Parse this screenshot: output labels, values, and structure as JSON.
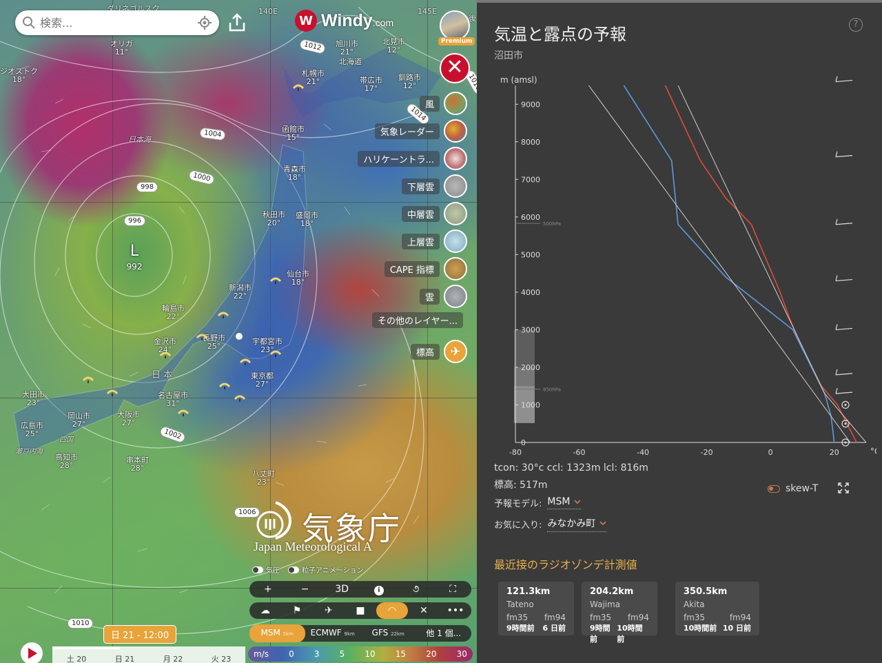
{
  "search": {
    "placeholder": "検索..."
  },
  "logo": {
    "name": "Windy",
    "suffix": ".com"
  },
  "badge": {
    "premium": "Premium"
  },
  "coords": {
    "lon1": "140E",
    "lon2": "145E",
    "top_left": "ダリネゴルスク",
    "top_right": "後"
  },
  "sea_labels": {
    "japan_sea": "日本海",
    "japan": "日 本",
    "shikoku": "四国",
    "setouchi": "瀬戸内海"
  },
  "low": {
    "letter": "L",
    "value": "992"
  },
  "pressure_tags": [
    "1012",
    "1014",
    "1004",
    "1000",
    "998",
    "996",
    "1002",
    "1006",
    "1010",
    "1016"
  ],
  "cities": [
    {
      "name": "オリガ",
      "temp": "11°"
    },
    {
      "name": "ジオストク",
      "temp": "18°"
    },
    {
      "name": "旭川市",
      "temp": "21°"
    },
    {
      "name": "北見市",
      "temp": "12°"
    },
    {
      "name": "北海道",
      "temp": ""
    },
    {
      "name": "札幌市",
      "temp": "21°"
    },
    {
      "name": "帯広市",
      "temp": "17°"
    },
    {
      "name": "釧路市",
      "temp": "12°"
    },
    {
      "name": "函館市",
      "temp": "15°"
    },
    {
      "name": "青森市",
      "temp": "18°"
    },
    {
      "name": "秋田市",
      "temp": "20°"
    },
    {
      "name": "盛岡市",
      "temp": "18°"
    },
    {
      "name": "仙台市",
      "temp": "18°"
    },
    {
      "name": "新潟市",
      "temp": "22°"
    },
    {
      "name": "輪島市",
      "temp": "22°"
    },
    {
      "name": "長野市",
      "temp": "25°"
    },
    {
      "name": "宇都宮市",
      "temp": "23°"
    },
    {
      "name": "金沢市",
      "temp": "24°"
    },
    {
      "name": "東京都",
      "temp": "27°"
    },
    {
      "name": "名古屋市",
      "temp": "31°"
    },
    {
      "name": "大田市",
      "temp": "23°"
    },
    {
      "name": "岡山市",
      "temp": "27°"
    },
    {
      "name": "大阪市",
      "temp": "27°"
    },
    {
      "name": "広島市",
      "temp": "25°"
    },
    {
      "name": "高知市",
      "temp": "28°"
    },
    {
      "name": "串本町",
      "temp": "28°"
    },
    {
      "name": "八丈町",
      "temp": "23°"
    }
  ],
  "layers": [
    {
      "label": "風",
      "color": "#6a8a5a"
    },
    {
      "label": "気象レーダー",
      "color": "#d0a040"
    },
    {
      "label": "ハリケーントラ...",
      "color": "#c07070"
    },
    {
      "label": "下層雲",
      "color": "#9a9a9a"
    },
    {
      "label": "中層雲",
      "color": "#a0a890"
    },
    {
      "label": "上層雲",
      "color": "#8ab0c0"
    },
    {
      "label": "CAPE 指標",
      "color": "#b09050"
    },
    {
      "label": "雲",
      "color": "#8a8f90"
    },
    {
      "label": "その他のレイヤー...",
      "color": ""
    },
    {
      "label": "標高",
      "color": "#e8a33a"
    }
  ],
  "jma": {
    "kanji": "気象庁",
    "english": "Japan Meteorological A"
  },
  "map_toggles": {
    "pressure": "気圧",
    "particles": "粒子アニメーション"
  },
  "toolbar1": {
    "plus": "+",
    "minus": "−",
    "three_d": "3D",
    "info": "i",
    "hurricane": "૭",
    "fullscreen": "⛶"
  },
  "toolbar2": {
    "weather": "☁",
    "flag": "⚑",
    "plane": "✈",
    "camera": "■",
    "paraglide": "◠",
    "cross": "✕",
    "more": "•••"
  },
  "models": [
    {
      "name": "MSM",
      "res": "5km"
    },
    {
      "name": "ECMWF",
      "res": "9km"
    },
    {
      "name": "GFS",
      "res": "22km"
    },
    {
      "name": "他 1 個...",
      "res": ""
    }
  ],
  "scale": {
    "unit": "m/s",
    "values": [
      "0",
      "3",
      "5",
      "10",
      "15",
      "20",
      "30"
    ]
  },
  "time": {
    "current": "日 21 - 12:00",
    "progress": 0.35,
    "days": [
      "土 20",
      "日 21",
      "月 22",
      "火 23"
    ]
  },
  "panel": {
    "title": "気温と露点の予報",
    "subtitle": "沼田市",
    "help": "?",
    "tcon_line": "tcon: 30°c ccl: 1323m lcl: 816m",
    "elevation_line": "標高: 517m",
    "skewt_label": "skew-T",
    "model_label": "予報モデル:",
    "model_value": "MSM",
    "fav_label": "お気に入り:",
    "fav_value": "みなかみ町",
    "radiosonde_title": "最近接のラジオゾンデ計測値",
    "stations": [
      {
        "dist": "121.3km",
        "name": "Tateno",
        "a": "fm35",
        "b": "fm94",
        "a_time": "9時間前",
        "b_time": "6 日前"
      },
      {
        "dist": "204.2km",
        "name": "Wajima",
        "a": "fm35",
        "b": "fm94",
        "a_time": "9時間前",
        "b_time": "10時間前"
      },
      {
        "dist": "350.5km",
        "name": "Akita",
        "a": "fm35",
        "b": "fm94",
        "a_time": "10時間前",
        "b_time": "10 日前"
      }
    ]
  },
  "chart_data": {
    "type": "line",
    "title": "気温と露点の予報",
    "ylabel": "m (amsl)",
    "xlabel": "°C",
    "xlim": [
      -80,
      30
    ],
    "ylim": [
      0,
      9500
    ],
    "x_ticks": [
      -80,
      -60,
      -40,
      -20,
      0,
      20
    ],
    "y_ticks": [
      0,
      1000,
      2000,
      3000,
      4000,
      5000,
      6000,
      7000,
      8000,
      9000
    ],
    "pressure_marks": [
      {
        "label": "850hPa",
        "alt": 1420
      },
      {
        "label": "500hPa",
        "alt": 5830
      }
    ],
    "terrain_alt": 517,
    "series": [
      {
        "name": "",
        "color": "#e04a3a",
        "points": [
          [
            27,
            0
          ],
          [
            24,
            500
          ],
          [
            21,
            1000
          ],
          [
            16,
            1500
          ],
          [
            10,
            2500
          ],
          [
            6,
            3300
          ],
          [
            3,
            4000
          ],
          [
            -2,
            5000
          ],
          [
            -6,
            5800
          ],
          [
            -14,
            6500
          ],
          [
            -22,
            7500
          ],
          [
            -33,
            9500
          ]
        ]
      },
      {
        "name": "",
        "color": "#5b9be0",
        "points": [
          [
            20,
            0
          ],
          [
            19,
            700
          ],
          [
            17,
            1300
          ],
          [
            7,
            3000
          ],
          [
            -5,
            3800
          ],
          [
            -14,
            4400
          ],
          [
            -29,
            5800
          ],
          [
            -31,
            7500
          ],
          [
            -46,
            9500
          ]
        ]
      },
      {
        "name": "",
        "color": "#cfcfcf",
        "points": [
          [
            30,
            0
          ],
          [
            17,
            1300
          ],
          [
            -29,
            9500
          ]
        ]
      },
      {
        "name": "",
        "color": "#cfcfcf",
        "points": [
          [
            25,
            0
          ],
          [
            -57,
            9500
          ]
        ]
      }
    ],
    "wind_barb_alts": [
      0,
      500,
      1000,
      1300,
      1800,
      3000,
      4300,
      5800,
      7600,
      9600
    ]
  }
}
